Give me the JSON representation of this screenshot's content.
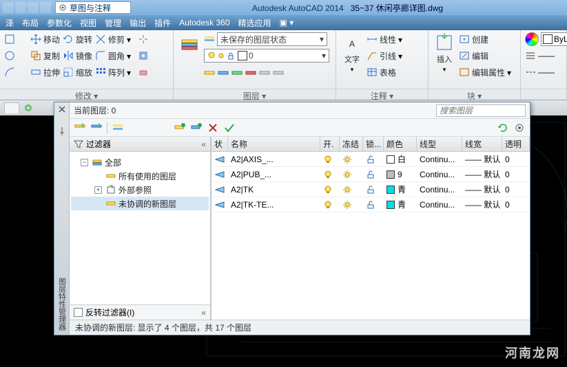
{
  "title": {
    "app": "Autodesk AutoCAD 2014",
    "file": "35~37 休闲亭廊详图.dwg"
  },
  "qat": {
    "combo": "草图与注释"
  },
  "menu": [
    "泽",
    "布局",
    "参数化",
    "视图",
    "管理",
    "输出",
    "插件",
    "Autodesk 360",
    "精选应用"
  ],
  "ribbon": {
    "modify": {
      "label": "修改 ▾",
      "move": "移动",
      "rotate": "旋转",
      "trim": "修剪",
      "copy": "复制",
      "mirror": "镜像",
      "fillet": "圆角",
      "stretch": "拉伸",
      "scale": "缩放",
      "array": "阵列"
    },
    "layer": {
      "label": "图层 ▾",
      "state": "未保存的图层状态",
      "current": "0"
    },
    "annot": {
      "label": "注释 ▾",
      "text": "文字",
      "linear": "线性",
      "leader": "引线",
      "table": "表格"
    },
    "block": {
      "label": "块 ▾",
      "insert": "插入",
      "create": "创建",
      "edit": "编辑",
      "editattr": "编辑属性"
    },
    "prop": {
      "bylayer": "ByLay"
    }
  },
  "palette": {
    "sideLabel": "图层特性管理器",
    "currentLabel": "当前图层: 0",
    "searchPlaceholder": "搜索图层",
    "filterHead": "过滤器",
    "invert": "反转过滤器(I)",
    "status": "未协调的新图层: 显示了 4 个图层，共 17 个图层",
    "tree": [
      {
        "label": "全部",
        "level": 1,
        "exp": "-",
        "icon": "all"
      },
      {
        "label": "所有使用的图层",
        "level": 2,
        "exp": "",
        "icon": "used"
      },
      {
        "label": "外部参照",
        "level": 2,
        "exp": "+",
        "icon": "xref"
      },
      {
        "label": "未协调的新图层",
        "level": 2,
        "exp": "",
        "icon": "new",
        "sel": true
      }
    ],
    "cols": {
      "status": "状",
      "name": "名称",
      "on": "开.",
      "freeze": "冻结",
      "lock": "锁...",
      "color": "颜色",
      "ltype": "线型",
      "lweight": "线宽",
      "trans": "透明"
    },
    "rows": [
      {
        "name": "A2|AXIS_...",
        "on": true,
        "fr": false,
        "lk": false,
        "colorSw": "white2",
        "colorName": "白",
        "lt": "Continu...",
        "lw": "—— 默认",
        "tr": "0"
      },
      {
        "name": "A2|PUB_...",
        "on": true,
        "fr": false,
        "lk": false,
        "colorSw": "gray",
        "colorName": "9",
        "lt": "Continu...",
        "lw": "—— 默认",
        "tr": "0"
      },
      {
        "name": "A2|TK",
        "on": true,
        "fr": false,
        "lk": false,
        "colorSw": "cyan",
        "colorName": "青",
        "lt": "Continu...",
        "lw": "—— 默认",
        "tr": "0"
      },
      {
        "name": "A2|TK-TE...",
        "on": true,
        "fr": false,
        "lk": false,
        "colorSw": "cyan",
        "colorName": "青",
        "lt": "Continu...",
        "lw": "—— 默认",
        "tr": "0"
      }
    ]
  },
  "watermark": "河南龙网"
}
